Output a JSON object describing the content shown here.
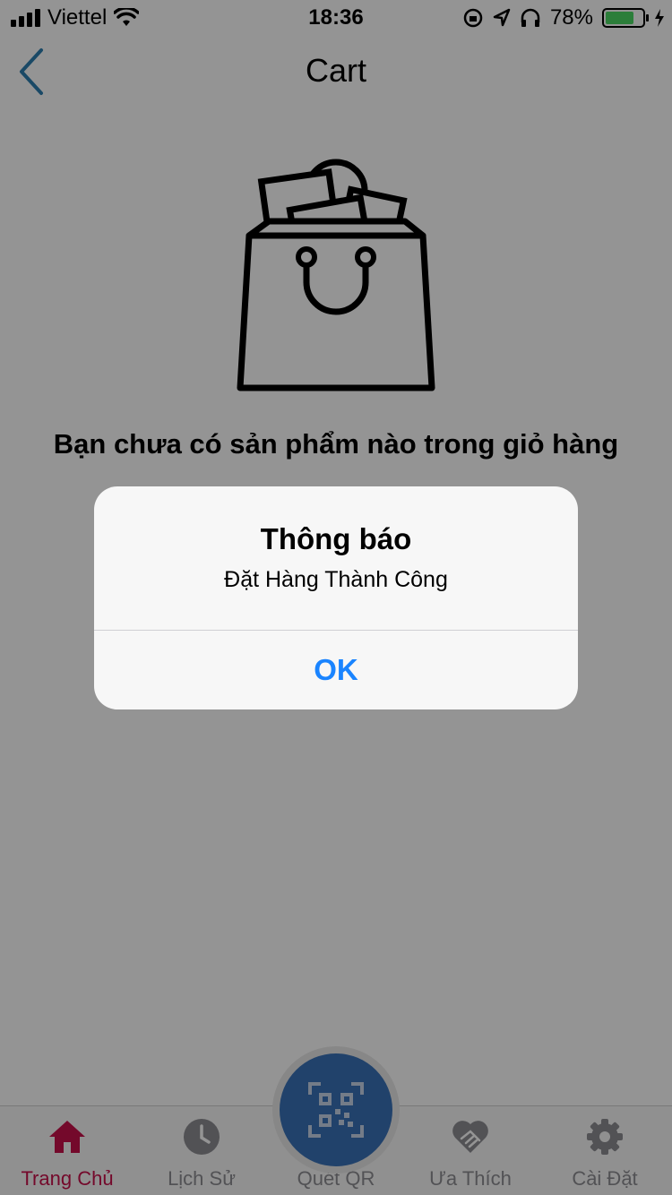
{
  "status_bar": {
    "carrier": "Viettel",
    "time": "18:36",
    "battery_percent": "78%",
    "battery_level": 0.78
  },
  "nav": {
    "title": "Cart",
    "back_icon": "chevron-left-icon",
    "accent_color": "#2d7fb0"
  },
  "empty_state": {
    "icon": "shopping-bag-icon",
    "message": "Bạn chưa có sản phẩm nào trong giỏ hàng"
  },
  "alert": {
    "title": "Thông báo",
    "message": "Đặt Hàng Thành Công",
    "ok_label": "OK",
    "ok_color": "#1a84ff"
  },
  "tab_bar": {
    "active_color": "#c8104a",
    "qr_color": "#3a73b8",
    "tabs": [
      {
        "label": "Trang Chủ",
        "icon": "home-icon",
        "active": true
      },
      {
        "label": "Lịch Sử",
        "icon": "clock-icon",
        "active": false
      },
      {
        "label": "Quét QR",
        "icon": "qr-code-icon",
        "active": false
      },
      {
        "label": "Ưa Thích",
        "icon": "heart-handshake-icon",
        "active": false
      },
      {
        "label": "Cài Đặt",
        "icon": "gear-icon",
        "active": false
      }
    ]
  }
}
